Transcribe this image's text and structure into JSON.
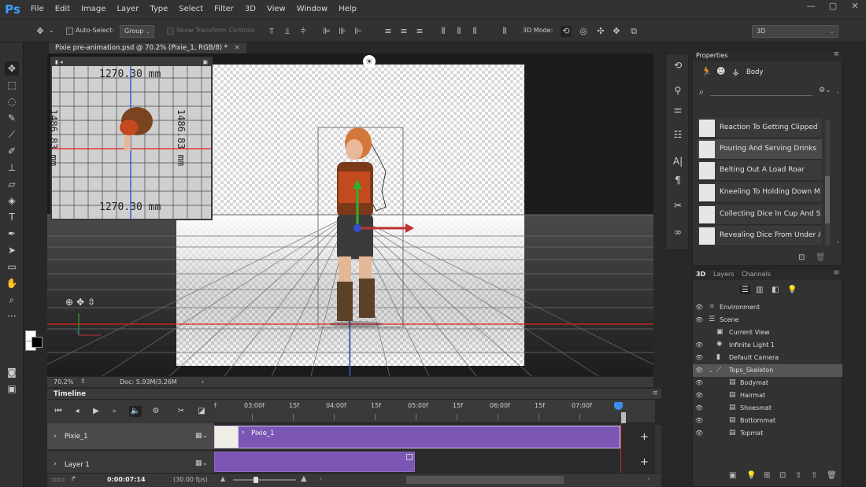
{
  "app": {
    "logo": "Ps"
  },
  "menu": [
    "File",
    "Edit",
    "Image",
    "Layer",
    "Type",
    "Select",
    "Filter",
    "3D",
    "View",
    "Window",
    "Help"
  ],
  "window_controls": {
    "minimize": "—",
    "restore": "▢",
    "close": "✕"
  },
  "options_bar": {
    "auto_select_label": "Auto-Select:",
    "auto_select_value": "Group",
    "show_transform_controls": "Show Transform Controls",
    "mode_label": "3D Mode:",
    "workspace": "3D"
  },
  "document": {
    "tab_title": "Pixie pre-animation.psd @ 70.2% (Pixie_1, RGB/8) *",
    "tab_close": "✕",
    "zoom": "70.2%",
    "doc_size": "Doc: 5.93M/3.26M"
  },
  "mini_view": {
    "top_measure": "1270.30 mm",
    "bottom_measure": "1270.30 mm",
    "left_measure": "1486.83 mm",
    "right_measure": "1486.83 mm",
    "camera_label": "▮ ◂"
  },
  "timeline": {
    "title": "Timeline",
    "ruler_labels": [
      "f",
      "03:00f",
      "15f",
      "04:00f",
      "15f",
      "05:00f",
      "15f",
      "06:00f",
      "15f",
      "07:00f",
      "f"
    ],
    "tracks": [
      {
        "name": "Pixie_1",
        "clip_label": "Pixie_1"
      },
      {
        "name": "Layer 1"
      }
    ],
    "timecode": "0:00:07:14",
    "fps": "(30.00 fps)"
  },
  "properties": {
    "title": "Properties",
    "mode": "Body",
    "animations": [
      {
        "label": "Reaction To Getting Clipped",
        "selected": false
      },
      {
        "label": "Pouring And Serving Drinks",
        "selected": true
      },
      {
        "label": "Belting Out A Load Roar",
        "selected": false
      },
      {
        "label": "Kneeling To Holding Down M",
        "selected": false
      },
      {
        "label": "Collecting Dice In Cup And S",
        "selected": false
      },
      {
        "label": "Revealing Dice From Under A",
        "selected": false
      }
    ]
  },
  "panel_3d": {
    "tabs": [
      "3D",
      "Layers",
      "Channels"
    ],
    "scene": [
      {
        "label": "Environment",
        "indent": 0,
        "icon": "☼",
        "selected": false
      },
      {
        "label": "Scene",
        "indent": 0,
        "icon": "☰",
        "selected": false
      },
      {
        "label": "Current View",
        "indent": 1,
        "icon": "▣",
        "selected": false
      },
      {
        "label": "Infinite Light 1",
        "indent": 1,
        "icon": "✺",
        "selected": false
      },
      {
        "label": "Default Camera",
        "indent": 1,
        "icon": "▮",
        "selected": false
      },
      {
        "label": "Tops_Skeleton",
        "indent": 1,
        "icon": "⟋",
        "selected": true
      },
      {
        "label": "Bodymat",
        "indent": 2,
        "icon": "▤",
        "selected": false
      },
      {
        "label": "Hairmat",
        "indent": 2,
        "icon": "▤",
        "selected": false
      },
      {
        "label": "Shoesmat",
        "indent": 2,
        "icon": "▤",
        "selected": false
      },
      {
        "label": "Bottommat",
        "indent": 2,
        "icon": "▤",
        "selected": false
      },
      {
        "label": "Topmat",
        "indent": 2,
        "icon": "▤",
        "selected": false
      }
    ]
  },
  "colors": {
    "accent": "#3ea0ff",
    "clip": "#7b56b4",
    "axis_red": "#e02020",
    "axis_blue": "#2040e0"
  }
}
